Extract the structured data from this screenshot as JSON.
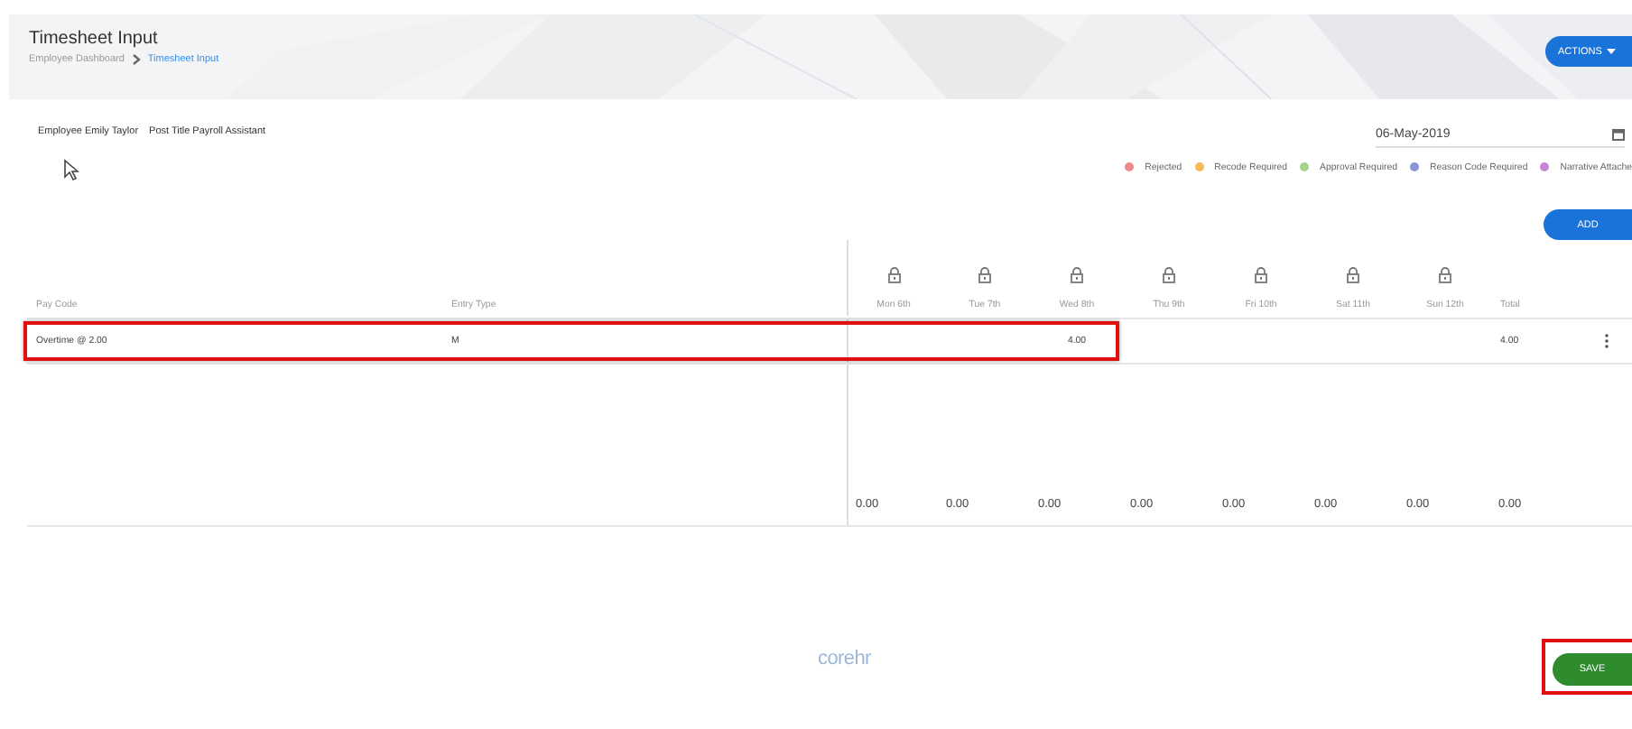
{
  "header": {
    "title": "Timesheet Input",
    "breadcrumb": [
      {
        "label": "Employee Dashboard",
        "selected": false
      },
      {
        "label": "Timesheet Input",
        "selected": true
      }
    ],
    "actions_button": "ACTIONS"
  },
  "employee": {
    "employee": "Employee Emily Taylor",
    "post": "Post Title Payroll Assistant"
  },
  "date_field": {
    "value": "06-May-2019"
  },
  "legend": [
    {
      "label": "Rejected",
      "color": "#f08a8a"
    },
    {
      "label": "Recode Required",
      "color": "#f5b957"
    },
    {
      "label": "Approval Required",
      "color": "#a9d18e"
    },
    {
      "label": "Reason Code Required",
      "color": "#8b95d6"
    },
    {
      "label": "Narrative Attache",
      "color": "#c684d6"
    }
  ],
  "add_button": "ADD",
  "table": {
    "columns": [
      "Pay Code",
      "Entry Type",
      "Mon 6th",
      "Tue 7th",
      "Wed 8th",
      "Thu 9th",
      "Fri 10th",
      "Sat 11th",
      "Sun 12th",
      "Total"
    ],
    "rows": [
      {
        "pay_code": "Overtime @ 2.00",
        "entry_type": "M",
        "days": {
          "wed": "4.00"
        },
        "total": "4.00",
        "highlighted": true
      }
    ],
    "totals": [
      "0.00",
      "0.00",
      "0.00",
      "0.00",
      "0.00",
      "0.00",
      "0.00",
      "0.00"
    ]
  },
  "footer": {
    "logo": "corehr",
    "save_button": "SAVE",
    "save_highlighted": true
  }
}
